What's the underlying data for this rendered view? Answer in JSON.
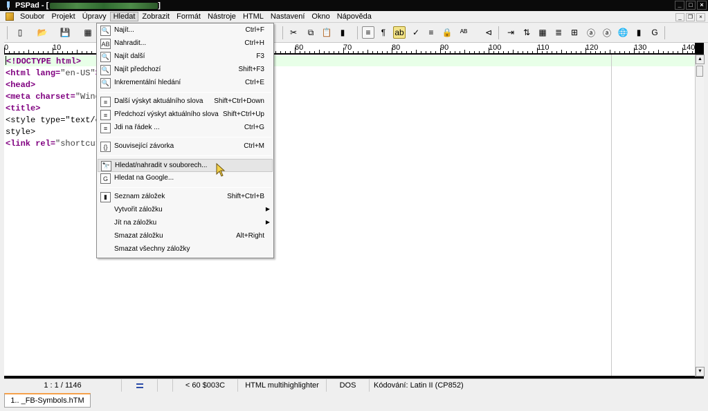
{
  "window": {
    "title": "PSPad - [",
    "title_close": "]"
  },
  "menubar": {
    "items": [
      "Soubor",
      "Projekt",
      "Úpravy",
      "Hledat",
      "Zobrazit",
      "Formát",
      "Nástroje",
      "HTML",
      "Nastavení",
      "Okno",
      "Nápověda"
    ],
    "active": "Hledat"
  },
  "ruler": {
    "labels": [
      "0",
      "10",
      "60",
      "70",
      "80",
      "90",
      "100",
      "110",
      "120",
      "130",
      "140"
    ]
  },
  "editor": {
    "lines": [
      {
        "parts": [
          [
            "tag",
            "<!DOCTYPE html>"
          ]
        ]
      },
      {
        "parts": [
          [
            "tag",
            "<html "
          ],
          [
            "attr",
            "lang="
          ],
          [
            "str",
            "\"en-US\""
          ],
          [
            "tag",
            ">"
          ]
        ]
      },
      {
        "parts": [
          [
            "tag",
            "<head>"
          ]
        ]
      },
      {
        "parts": [
          [
            "tag",
            "<meta "
          ],
          [
            "attr",
            "charset="
          ],
          [
            "str",
            "\"Wind"
          ]
        ]
      },
      {
        "parts": [
          [
            "tag",
            "<title>"
          ]
        ]
      },
      {
        "parts": [
          [
            "plain",
            "<style type=\"text/c"
          ]
        ]
      },
      {
        "parts": [
          [
            "plain",
            "style>"
          ]
        ]
      },
      {
        "parts": [
          [
            "tag",
            "<link "
          ],
          [
            "attr",
            "rel="
          ],
          [
            "str",
            "\"shortcut"
          ]
        ]
      }
    ]
  },
  "search_menu": {
    "groups": [
      [
        {
          "icon": "find-icon",
          "glyph": "🔍",
          "label": "Najít...",
          "shortcut": "Ctrl+F"
        },
        {
          "icon": "replace-icon",
          "glyph": "AB",
          "label": "Nahradit...",
          "shortcut": "Ctrl+H"
        },
        {
          "icon": "find-next-icon",
          "glyph": "🔍",
          "label": "Najít další",
          "shortcut": "F3"
        },
        {
          "icon": "find-previous-icon",
          "glyph": "🔍",
          "label": "Najít předchozí",
          "shortcut": "Shift+F3"
        },
        {
          "icon": "incremental-search-icon",
          "glyph": "🔍",
          "label": "Inkrementální hledání",
          "shortcut": "Ctrl+E"
        }
      ],
      [
        {
          "icon": "next-word-icon",
          "glyph": "≡",
          "label": "Další výskyt aktuálního slova",
          "shortcut": "Shift+Ctrl+Down"
        },
        {
          "icon": "previous-word-icon",
          "glyph": "≡",
          "label": "Předchozí výskyt aktuálního slova",
          "shortcut": "Shift+Ctrl+Up"
        },
        {
          "icon": "goto-line-icon",
          "glyph": "≡",
          "label": "Jdi na řádek ...",
          "shortcut": "Ctrl+G"
        }
      ],
      [
        {
          "icon": "matching-brace-icon",
          "glyph": "{}",
          "label": "Související závorka",
          "shortcut": "Ctrl+M"
        }
      ],
      [
        {
          "icon": "find-in-files-icon",
          "glyph": "🔭",
          "label": "Hledat/nahradit v souborech...",
          "shortcut": "",
          "hover": true
        },
        {
          "icon": "google-icon",
          "glyph": "G",
          "label": "Hledat na Google...",
          "shortcut": ""
        }
      ],
      [
        {
          "icon": "bookmark-list-icon",
          "glyph": "▮",
          "label": "Seznam záložek",
          "shortcut": "Shift+Ctrl+B"
        },
        {
          "icon": "",
          "glyph": "",
          "label": "Vytvořit záložku",
          "shortcut": "",
          "submenu": true
        },
        {
          "icon": "",
          "glyph": "",
          "label": "Jít na záložku",
          "shortcut": "",
          "submenu": true
        },
        {
          "icon": "",
          "glyph": "",
          "label": "Smazat záložku",
          "shortcut": "Alt+Right"
        },
        {
          "icon": "",
          "glyph": "",
          "label": "Smazat všechny záložky",
          "shortcut": ""
        }
      ]
    ]
  },
  "statusbar": {
    "position": "1 : 1 / 1146",
    "char_info": "<  60  $003C",
    "highlighter": "HTML multihighlighter",
    "line_ending": "DOS",
    "encoding": "Kódování: Latin II (CP852)"
  },
  "tabs": [
    {
      "label": "1.. _FB-Symbols.hTM"
    }
  ],
  "colors": {
    "tag": "#800080",
    "current_line": "#e8ffe8",
    "active_tab_accent": "#f5a04a"
  }
}
